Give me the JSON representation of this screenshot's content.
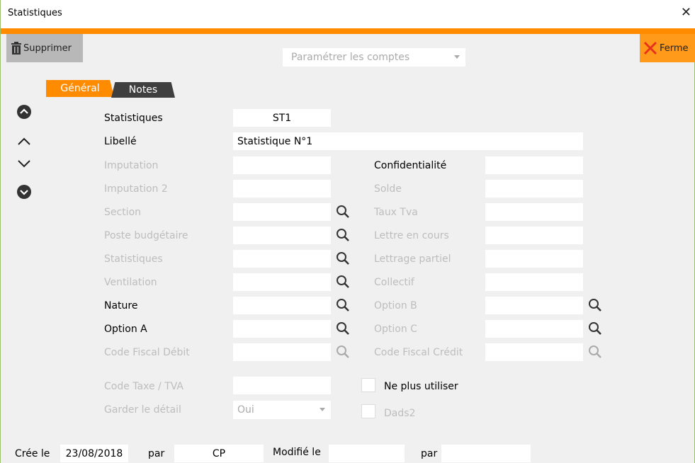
{
  "window": {
    "title": "Statistiques"
  },
  "toolbar": {
    "delete_label": "Supprimer",
    "close_label": "Ferme"
  },
  "accounts_select": {
    "placeholder": "Paramétrer les comptes"
  },
  "tabs": [
    {
      "label": "Général",
      "active": true
    },
    {
      "label": "Notes",
      "active": false
    }
  ],
  "colors": {
    "accent": "#ff8c00",
    "disabled_text": "#bdbdbd"
  },
  "form": {
    "statistiques": {
      "label": "Statistiques",
      "value": "ST1"
    },
    "libelle": {
      "label": "Libellé",
      "value": "Statistique N°1"
    },
    "imputation": {
      "label": "Imputation",
      "value": ""
    },
    "imputation2": {
      "label": "Imputation 2",
      "value": ""
    },
    "section": {
      "label": "Section",
      "value": ""
    },
    "poste_budgetaire": {
      "label": "Poste budgétaire",
      "value": ""
    },
    "statistiques2": {
      "label": "Statistiques",
      "value": ""
    },
    "ventilation": {
      "label": "Ventilation",
      "value": ""
    },
    "nature": {
      "label": "Nature",
      "value": ""
    },
    "option_a": {
      "label": "Option A",
      "value": ""
    },
    "code_fiscal_debit": {
      "label": "Code Fiscal Débit",
      "value": ""
    },
    "code_taxe": {
      "label": "Code Taxe / TVA",
      "value": ""
    },
    "garder_detail": {
      "label": "Garder le détail",
      "value": "Oui"
    },
    "confidentialite": {
      "label": "Confidentialité",
      "value": ""
    },
    "solde": {
      "label": "Solde",
      "value": ""
    },
    "taux_tva": {
      "label": "Taux Tva",
      "value": ""
    },
    "lettre_en_cours": {
      "label": "Lettre en cours",
      "value": ""
    },
    "lettrage_partiel": {
      "label": "Lettrage partiel",
      "value": ""
    },
    "collectif": {
      "label": "Collectif",
      "value": ""
    },
    "option_b": {
      "label": "Option B",
      "value": ""
    },
    "option_c": {
      "label": "Option C",
      "value": ""
    },
    "code_fiscal_credit": {
      "label": "Code Fiscal Crédit",
      "value": ""
    },
    "ne_plus_utiliser": {
      "label": "Ne plus utiliser",
      "checked": false
    },
    "dads2": {
      "label": "Dads2",
      "checked": false
    }
  },
  "footer": {
    "created_label": "Crée le",
    "created_date": "23/08/2018",
    "by_label": "par",
    "created_by": "CP",
    "modified_label": "Modifié le",
    "modified_date": "",
    "by_label2": "par",
    "modified_by": ""
  }
}
